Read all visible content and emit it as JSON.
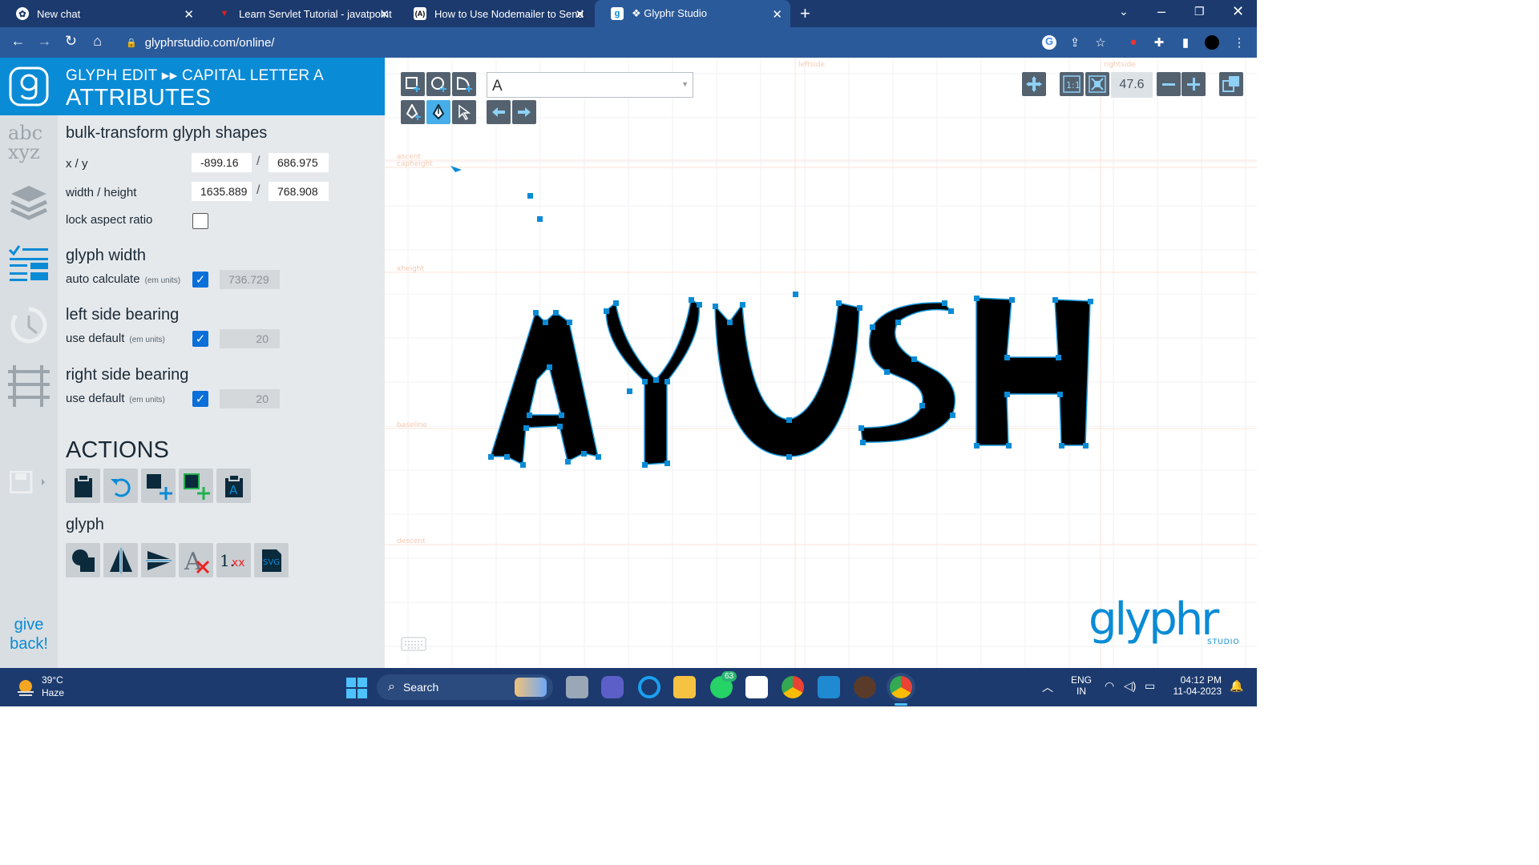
{
  "browser": {
    "tabs": [
      {
        "title": "New chat",
        "favicon": "chatgpt-icon"
      },
      {
        "title": "Learn Servlet Tutorial - javatpoint",
        "favicon": "javatpoint-icon"
      },
      {
        "title": "How to Use Nodemailer to Send",
        "favicon": "nodemailer-icon"
      },
      {
        "title": "❖ Glyphr Studio",
        "favicon": "glyphr-icon"
      }
    ],
    "url": "glyphrstudio.com/online/"
  },
  "sidebar": {
    "give_back": "give back!"
  },
  "panel": {
    "breadcrumb": "GLYPH EDIT  ▸▸  CAPITAL LETTER A",
    "title": "ATTRIBUTES",
    "bulk_title": "bulk-transform glyph shapes",
    "xy_label": "x / y",
    "x_value": "-899.16",
    "y_value": "686.975",
    "wh_label": "width / height",
    "width_value": "1635.889",
    "height_value": "768.908",
    "lock_label": "lock aspect ratio",
    "glyph_width_title": "glyph width",
    "auto_calc_label": "auto calculate",
    "em_units": "(em units)",
    "glyph_width_value": "736.729",
    "lsb_title": "left side bearing",
    "use_default": "use default",
    "lsb_value": "20",
    "rsb_title": "right side bearing",
    "rsb_value": "20",
    "actions_title": "ACTIONS",
    "glyph_title": "glyph"
  },
  "canvas": {
    "glyph_select": "A",
    "zoom": "47.6",
    "text": "AYUSH",
    "guides": [
      "leftside",
      "rightside",
      "ascent",
      "capheight",
      "xheight",
      "baseline",
      "descent"
    ]
  },
  "taskbar": {
    "weather_temp": "39°C",
    "weather_desc": "Haze",
    "search_label": "Search",
    "whatsapp_badge": "63",
    "lang": "ENG",
    "region": "IN",
    "time": "04:12 PM",
    "date": "11-04-2023"
  },
  "colors": {
    "accent": "#0a8bd6",
    "tabbar": "#1c3a6e",
    "panel": "#e6e9ec"
  }
}
